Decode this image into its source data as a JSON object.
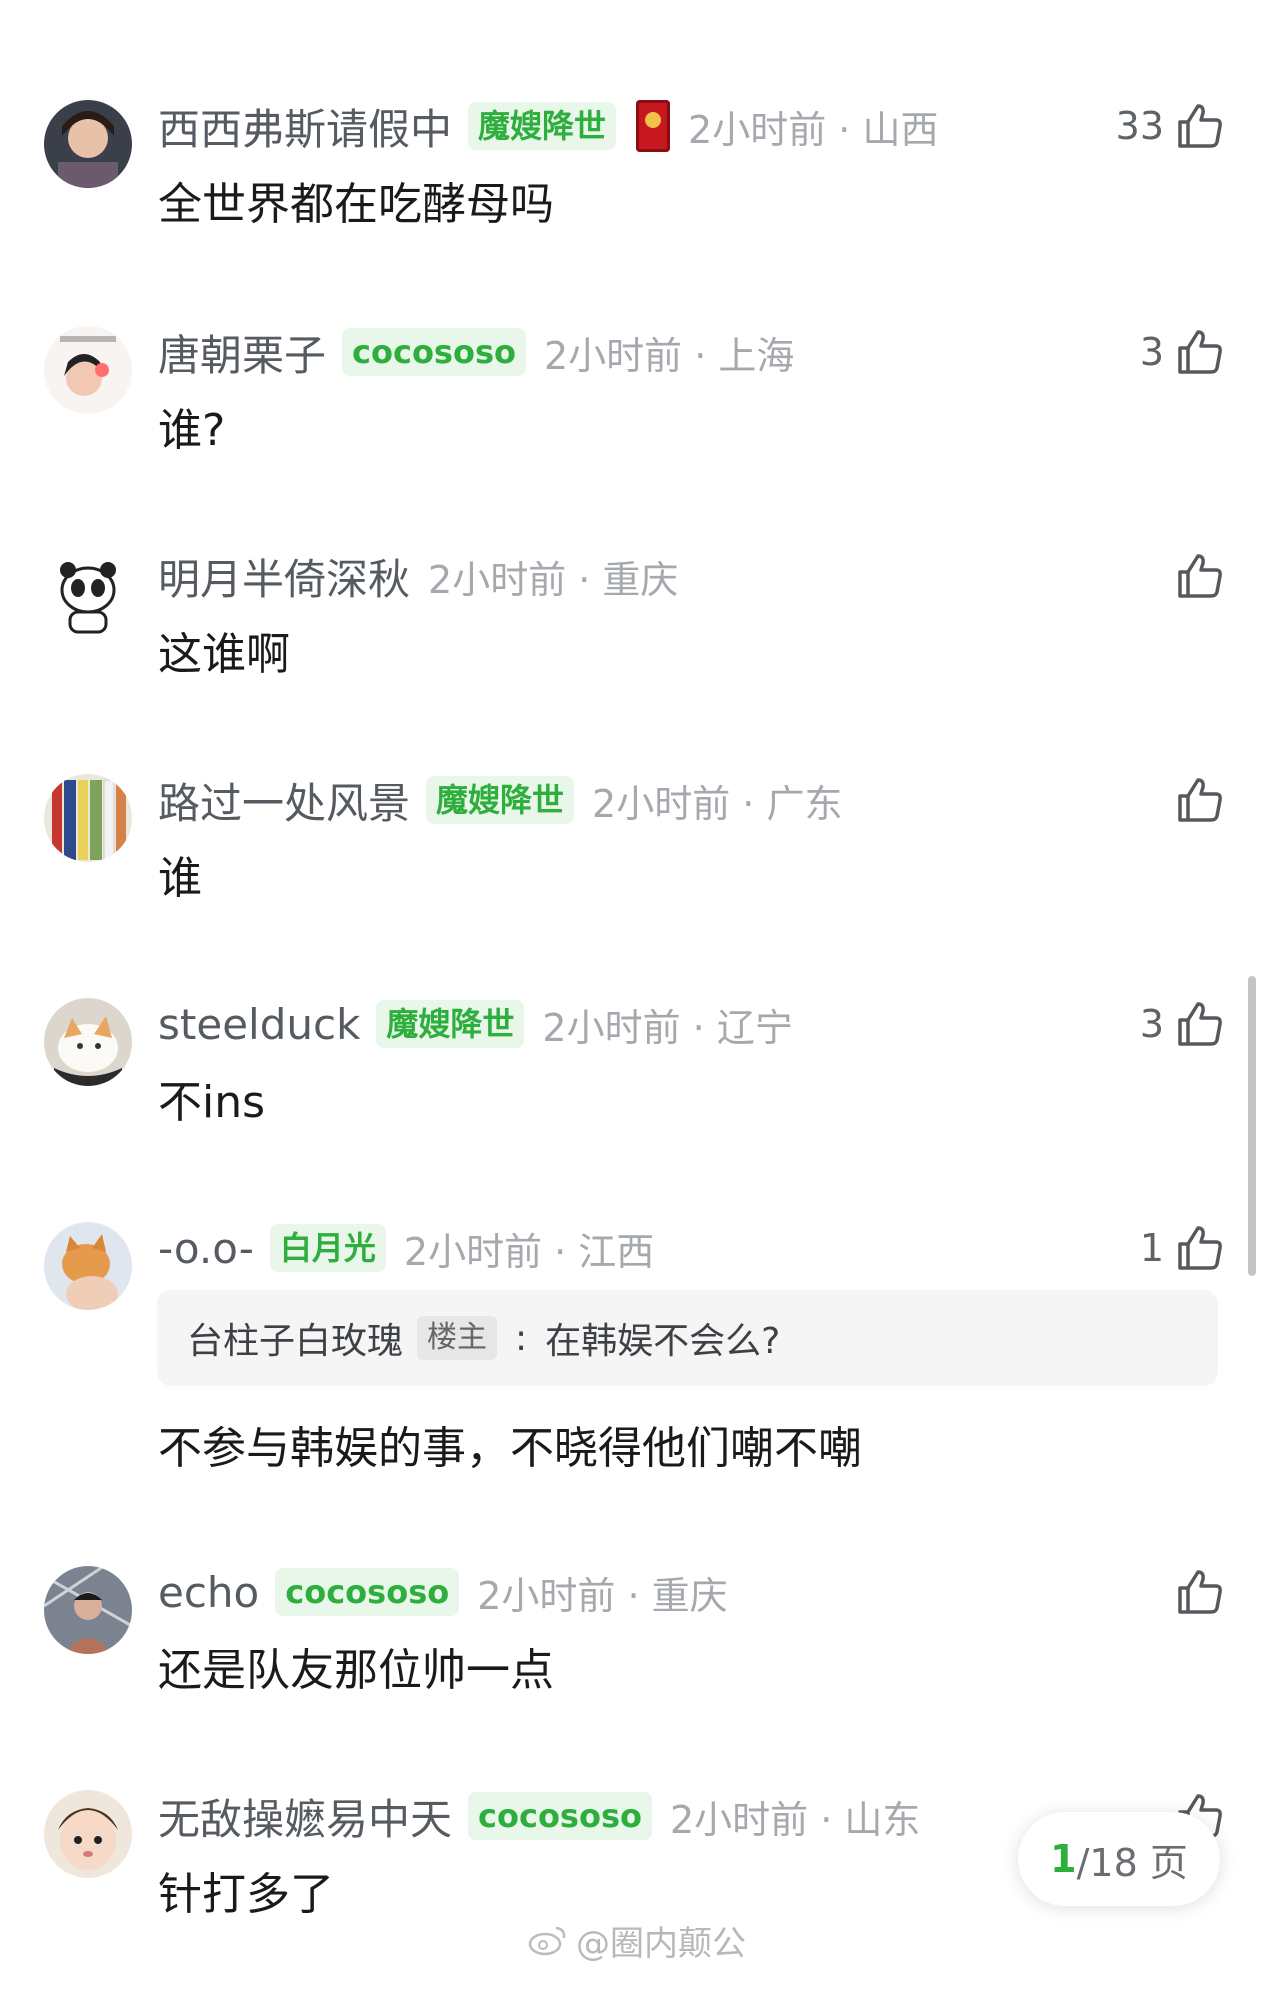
{
  "comments": [
    {
      "username": "西西弗斯请假中",
      "badge": "魔嫂降世",
      "has_medal": true,
      "meta": "2小时前 · 山西",
      "likes": "33",
      "text": "全世界都在吃酵母吗"
    },
    {
      "username": "唐朝栗子",
      "badge": "cocososo",
      "meta": "2小时前 · 上海",
      "likes": "3",
      "text": "谁?"
    },
    {
      "username": "明月半倚深秋",
      "meta": "2小时前 · 重庆",
      "likes": "",
      "text": "这谁啊"
    },
    {
      "username": "路过一处风景",
      "badge": "魔嫂降世",
      "meta": "2小时前 · 广东",
      "likes": "",
      "text": "谁"
    },
    {
      "username": "steelduck",
      "badge": "魔嫂降世",
      "meta": "2小时前 · 辽宁",
      "likes": "3",
      "text": "不ins"
    },
    {
      "username": "-o.o-",
      "badge": "白月光",
      "meta": "2小时前 · 江西",
      "likes": "1",
      "quote": {
        "author": "台柱子白玫瑰",
        "tag": "楼主",
        "separator": ":",
        "text": "在韩娱不会么?"
      },
      "text": "不参与韩娱的事，不晓得他们嘲不嘲"
    },
    {
      "username": "echo",
      "badge": "cocososo",
      "meta": "2小时前 · 重庆",
      "likes": "",
      "text": "还是队友那位帅一点"
    },
    {
      "username": "无敌操嬷易中天",
      "badge": "cocososo",
      "meta": "2小时前 · 山东",
      "likes": "",
      "text": "针打多了"
    }
  ],
  "pager": {
    "current": "1",
    "total_text": "/18 页"
  },
  "watermark": {
    "text": "@圈内颠公"
  },
  "colors": {
    "badge_text": "#2eae3c",
    "badge_bg": "#e9f7ea",
    "meta": "#a5a9ae",
    "username": "#555b61"
  },
  "icons": {
    "like": "thumbs-up-icon",
    "weibo": "weibo-logo-icon"
  }
}
